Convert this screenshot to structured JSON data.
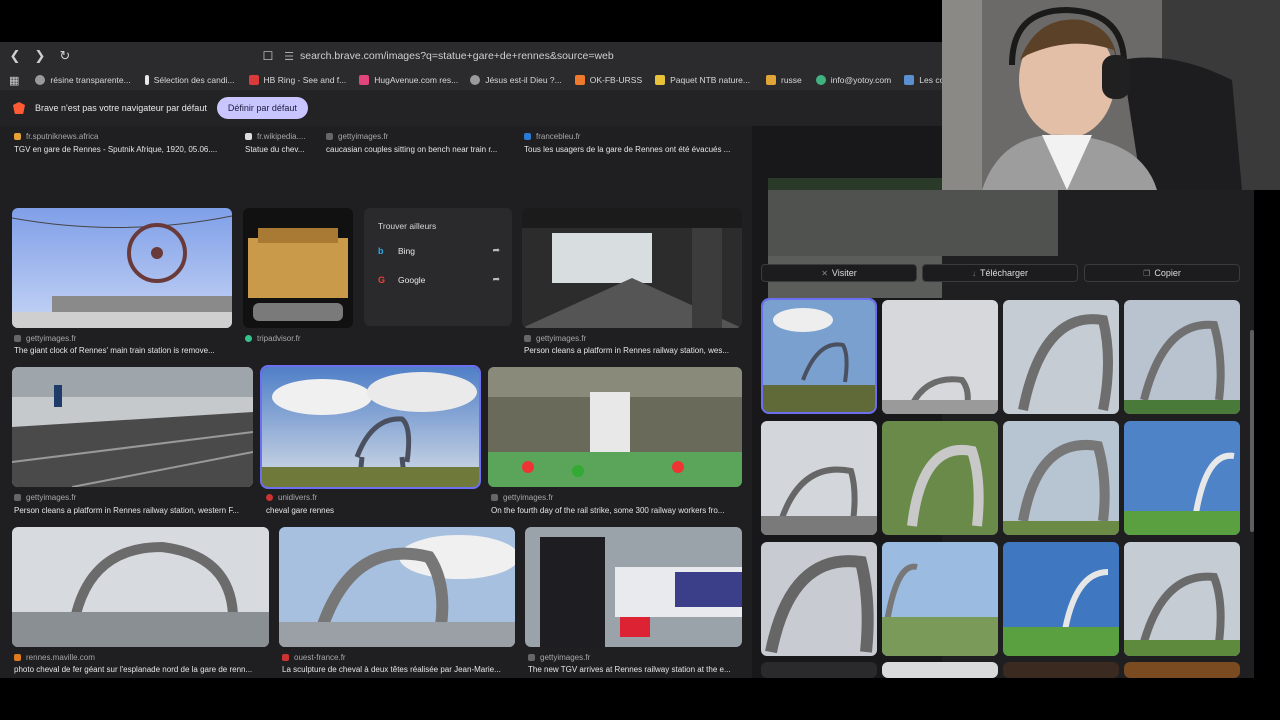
{
  "browser": {
    "url": "search.brave.com/images?q=statue+gare+de+rennes&source=web"
  },
  "bookmarks": [
    {
      "label": "résine transparente...",
      "color": "#9a9a9a"
    },
    {
      "label": "Sélection des candi...",
      "color": "#e8e8e8"
    },
    {
      "label": "HB Ring - See and f...",
      "color": "#d93a3a"
    },
    {
      "label": "HugAvenue.com res...",
      "color": "#e0457b"
    },
    {
      "label": "Jésus est-il Dieu ?...",
      "color": "#9a9a9a"
    },
    {
      "label": "OK-FB-URSS",
      "color": "#f07a2c"
    },
    {
      "label": "Paquet NTB nature...",
      "color": "#e7c23b"
    },
    {
      "label": "russe",
      "color": "#e0a536"
    },
    {
      "label": "info@yotoy.com",
      "color": "#3fb37f"
    },
    {
      "label": "Les concours d'aute...",
      "color": "#5a8fd0"
    }
  ],
  "banner": {
    "text": "Brave n'est pas votre navigateur par défaut",
    "button": "Définir par défaut"
  },
  "top_row": [
    {
      "source": "fr.sputniknews.africa",
      "caption": "TGV en gare de Rennes - Sputnik Afrique, 1920, 05.06...."
    },
    {
      "source": "fr.wikipedia....",
      "caption": "Statue du chev..."
    },
    {
      "source": "gettyimages.fr",
      "caption": "caucasian couples sitting on bench near train r..."
    },
    {
      "source": "francebleu.fr",
      "caption": "Tous les usagers de la gare de Rennes ont été évacués ..."
    }
  ],
  "row2": [
    {
      "source": "gettyimages.fr",
      "caption": "The giant clock of Rennes' main train station is remove..."
    },
    {
      "source": "tripadvisor.fr",
      "caption": ""
    },
    {
      "source": "gettyimages.fr",
      "caption": "Person cleans a platform in Rennes railway station, wes..."
    }
  ],
  "popup": {
    "title": "Trouver ailleurs",
    "options": [
      "Bing",
      "Google"
    ]
  },
  "row3": [
    {
      "source": "gettyimages.fr",
      "caption": "Person cleans a platform in Rennes railway station, western F..."
    },
    {
      "source": "unidivers.fr",
      "caption": "cheval gare rennes"
    },
    {
      "source": "gettyimages.fr",
      "caption": "On the fourth day of the rail strike, some 300 railway workers fro..."
    }
  ],
  "row4": [
    {
      "source": "rennes.maville.com",
      "caption": "photo cheval de fer géant sur l'esplanade nord de la gare de renn..."
    },
    {
      "source": "ouest-france.fr",
      "caption": "La sculpture de cheval à deux têtes réalisée par Jean-Marie..."
    },
    {
      "source": "gettyimages.fr",
      "caption": "The new TGV arrives at Rennes railway station at the e..."
    }
  ],
  "panel": {
    "visit": "Visiter",
    "download": "Télécharger",
    "copy": "Copier"
  },
  "colors": {
    "accent": "#6c6ff0",
    "banner_button": "#c9c5ff"
  }
}
